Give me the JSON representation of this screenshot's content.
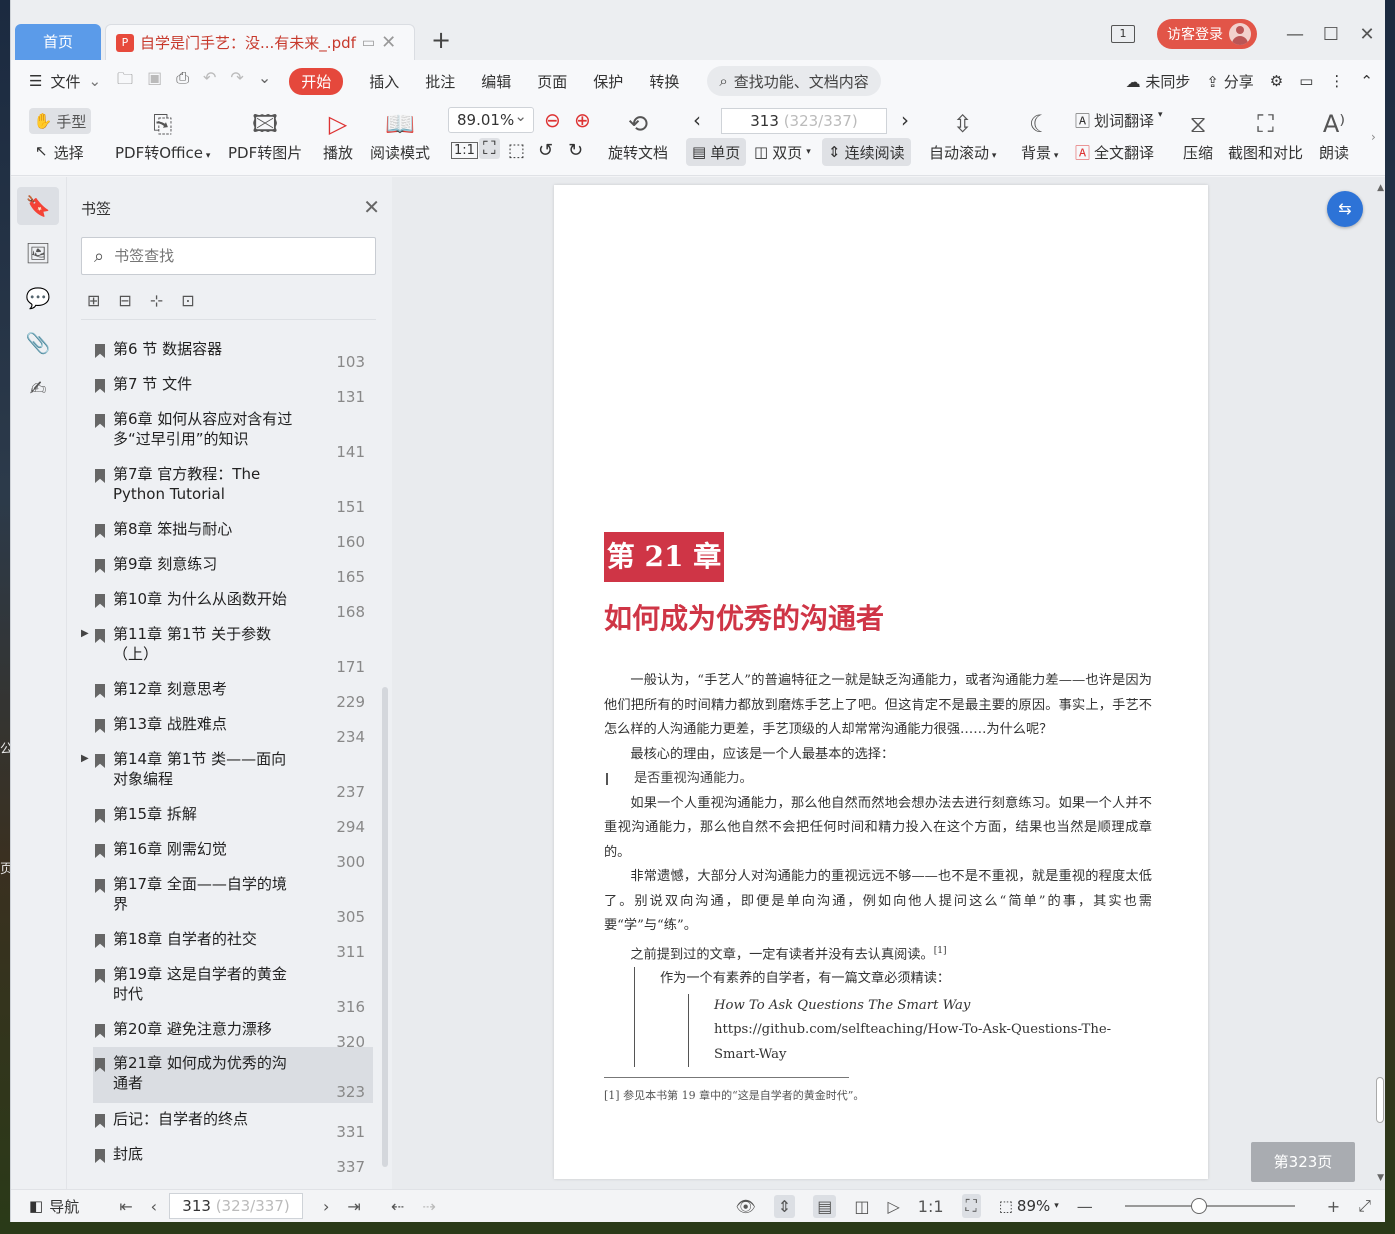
{
  "titlebar": {
    "home_tab": "首页",
    "doc_tab_title": "自学是门手艺：没...有未来_.pdf",
    "page_count_badge": "1",
    "login_label": "访客登录"
  },
  "menubar": {
    "file": "文件",
    "items": [
      "开始",
      "插入",
      "批注",
      "编辑",
      "页面",
      "保护",
      "转换"
    ],
    "search_placeholder": "查找功能、文档内容",
    "sync": "未同步",
    "share": "分享"
  },
  "ribbon": {
    "hand": "手型",
    "select": "选择",
    "pdf_office": "PDF转Office",
    "pdf_image": "PDF转图片",
    "play": "播放",
    "read_mode": "阅读模式",
    "zoom": "89.01%",
    "rotate": "旋转文档",
    "page_current": "313",
    "page_total": "(323/337)",
    "single": "单页",
    "double": "双页",
    "continuous": "连续阅读",
    "auto_scroll": "自动滚动",
    "background": "背景",
    "word_translate": "划词翻译",
    "full_translate": "全文翻译",
    "compress": "压缩",
    "screenshot": "截图和对比",
    "read_aloud": "朗读"
  },
  "bookmarks": {
    "title": "书签",
    "search_placeholder": "书签查找",
    "items": [
      {
        "label": "第6 节 数据容器",
        "page": "103"
      },
      {
        "label": "第7 节 文件",
        "page": "131"
      },
      {
        "label": "第6章 如何从容应对含有过多“过早引用”的知识",
        "page": "141"
      },
      {
        "label": "第7章 官方教程：The Python Tutorial",
        "page": "151"
      },
      {
        "label": "第8章 笨拙与耐心",
        "page": "160"
      },
      {
        "label": "第9章 刻意练习",
        "page": "165"
      },
      {
        "label": "第10章 为什么从函数开始",
        "page": "168"
      },
      {
        "label": "第11章 第1节 关于参数（上）",
        "page": "171"
      },
      {
        "label": "第12章 刻意思考",
        "page": "229"
      },
      {
        "label": "第13章 战胜难点",
        "page": "234"
      },
      {
        "label": "第14章 第1节 类——面向对象编程",
        "page": "237"
      },
      {
        "label": "第15章 拆解",
        "page": "294"
      },
      {
        "label": "第16章 刚需幻觉",
        "page": "300"
      },
      {
        "label": "第17章 全面——自学的境界",
        "page": "305"
      },
      {
        "label": "第18章 自学者的社交",
        "page": "311"
      },
      {
        "label": "第19章 这是自学者的黄金时代",
        "page": "316"
      },
      {
        "label": "第20章 避免注意力漂移",
        "page": "320"
      },
      {
        "label": "第21章 如何成为优秀的沟通者",
        "page": "323"
      },
      {
        "label": "后记：自学者的终点",
        "page": "331"
      },
      {
        "label": "封底",
        "page": "337"
      }
    ]
  },
  "document": {
    "chapter_no": "第 21 章",
    "chapter_title": "如何成为优秀的沟通者",
    "p1": "一般认为，“手艺人”的普遍特征之一就是缺乏沟通能力，或者沟通能力差——也许是因为他们把所有的时间精力都放到磨炼手艺上了吧。但这肯定不是最主要的原因。事实上，手艺不怎么样的人沟通能力更差，手艺顶级的人却常常沟通能力很强……为什么呢？",
    "p2": "最核心的理由，应该是一个人最基本的选择：",
    "q1": "是否重视沟通能力。",
    "p3": "如果一个人重视沟通能力，那么他自然而然地会想办法去进行刻意练习。如果一个人并不重视沟通能力，那么他自然不会把任何时间和精力投入在这个方面，结果也当然是顺理成章的。",
    "p4": "非常遗憾，大部分人对沟通能力的重视远远不够——也不是不重视，就是重视的程度太低了。别说双向沟通，即便是单向沟通，例如向他人提问这么“简单”的事，其实也需要“学”与“练”。",
    "p5": "之前提到过的文章，一定有读者并没有去认真阅读。",
    "fn_mark": "[1]",
    "q2": "作为一个有素养的自学者，有一篇文章必须精读：",
    "q3": "How To Ask Questions The Smart Way",
    "q4": "https://github.com/selfteaching/How-To-Ask-Questions-The-Smart-Way",
    "footnote": "[1] 参见本书第 19 章中的“这是自学者的黄金时代”。",
    "page_toast": "第323页"
  },
  "statusbar": {
    "nav": "导航",
    "page_current": "313",
    "page_total": "(323/337)",
    "zoom": "89%"
  },
  "colors": {
    "accent": "#e5483c",
    "chapter": "#cf3546",
    "home_tab": "#5b9be9"
  }
}
